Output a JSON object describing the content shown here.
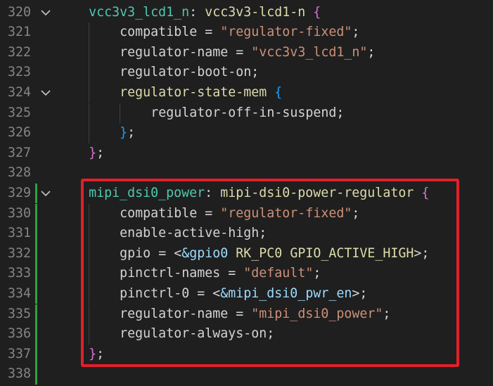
{
  "colors": {
    "background": "#1f1f1f",
    "line_number": "#858585",
    "label": "#4ec9b0",
    "node_name": "#dcdcaa",
    "property": "#d4d4d4",
    "string": "#ce9178",
    "reference": "#9cdcfe",
    "brace_outer": "#da70d6",
    "brace_inner": "#179fff",
    "highlight_border": "#e0202a",
    "modified_gutter": "#2ea043"
  },
  "lines": [
    {
      "n": "320",
      "fold": true,
      "modified": false,
      "indent": 1,
      "tokens": [
        {
          "t": "vcc3v3_lcd1_n",
          "c": "label"
        },
        {
          "t": ": ",
          "c": "punct"
        },
        {
          "t": "vcc3v3-lcd1-n",
          "c": "node"
        },
        {
          "t": " ",
          "c": "punct"
        },
        {
          "t": "{",
          "c": "brace1"
        }
      ]
    },
    {
      "n": "321",
      "fold": false,
      "modified": false,
      "indent": 2,
      "tokens": [
        {
          "t": "compatible",
          "c": "prop"
        },
        {
          "t": " = ",
          "c": "punct"
        },
        {
          "t": "\"regulator-fixed\"",
          "c": "str"
        },
        {
          "t": ";",
          "c": "punct"
        }
      ]
    },
    {
      "n": "322",
      "fold": false,
      "modified": false,
      "indent": 2,
      "tokens": [
        {
          "t": "regulator-name",
          "c": "prop"
        },
        {
          "t": " = ",
          "c": "punct"
        },
        {
          "t": "\"vcc3v3_lcd1_n\"",
          "c": "str"
        },
        {
          "t": ";",
          "c": "punct"
        }
      ]
    },
    {
      "n": "323",
      "fold": false,
      "modified": false,
      "indent": 2,
      "tokens": [
        {
          "t": "regulator-boot-on",
          "c": "prop"
        },
        {
          "t": ";",
          "c": "punct"
        }
      ]
    },
    {
      "n": "324",
      "fold": true,
      "modified": false,
      "indent": 2,
      "tokens": [
        {
          "t": "regulator-state-mem",
          "c": "node"
        },
        {
          "t": " ",
          "c": "punct"
        },
        {
          "t": "{",
          "c": "brace2"
        }
      ]
    },
    {
      "n": "325",
      "fold": false,
      "modified": false,
      "indent": 3,
      "tokens": [
        {
          "t": "regulator-off-in-suspend",
          "c": "prop"
        },
        {
          "t": ";",
          "c": "punct"
        }
      ]
    },
    {
      "n": "326",
      "fold": false,
      "modified": false,
      "indent": 2,
      "tokens": [
        {
          "t": "}",
          "c": "brace2"
        },
        {
          "t": ";",
          "c": "punct"
        }
      ]
    },
    {
      "n": "327",
      "fold": false,
      "modified": false,
      "indent": 1,
      "tokens": [
        {
          "t": "}",
          "c": "brace1"
        },
        {
          "t": ";",
          "c": "punct"
        }
      ]
    },
    {
      "n": "328",
      "fold": false,
      "modified": false,
      "indent": 0,
      "tokens": []
    },
    {
      "n": "329",
      "fold": true,
      "modified": true,
      "indent": 1,
      "tokens": [
        {
          "t": "mipi_dsi0_power",
          "c": "label"
        },
        {
          "t": ": ",
          "c": "punct"
        },
        {
          "t": "mipi-dsi0-power-regulator",
          "c": "node"
        },
        {
          "t": " ",
          "c": "punct"
        },
        {
          "t": "{",
          "c": "brace1"
        }
      ]
    },
    {
      "n": "330",
      "fold": false,
      "modified": true,
      "indent": 2,
      "tokens": [
        {
          "t": "compatible",
          "c": "prop"
        },
        {
          "t": " = ",
          "c": "punct"
        },
        {
          "t": "\"regulator-fixed\"",
          "c": "str"
        },
        {
          "t": ";",
          "c": "punct"
        }
      ]
    },
    {
      "n": "331",
      "fold": false,
      "modified": true,
      "indent": 2,
      "tokens": [
        {
          "t": "enable-active-high",
          "c": "prop"
        },
        {
          "t": ";",
          "c": "punct"
        }
      ]
    },
    {
      "n": "332",
      "fold": false,
      "modified": true,
      "indent": 2,
      "tokens": [
        {
          "t": "gpio",
          "c": "prop"
        },
        {
          "t": " = <",
          "c": "punct"
        },
        {
          "t": "&gpio0",
          "c": "ref"
        },
        {
          "t": " RK_PC0 GPIO_ACTIVE_HIGH",
          "c": "node"
        },
        {
          "t": ">;",
          "c": "punct"
        }
      ]
    },
    {
      "n": "333",
      "fold": false,
      "modified": true,
      "indent": 2,
      "tokens": [
        {
          "t": "pinctrl-names",
          "c": "prop"
        },
        {
          "t": " = ",
          "c": "punct"
        },
        {
          "t": "\"default\"",
          "c": "str"
        },
        {
          "t": ";",
          "c": "punct"
        }
      ]
    },
    {
      "n": "334",
      "fold": false,
      "modified": true,
      "indent": 2,
      "tokens": [
        {
          "t": "pinctrl-0",
          "c": "prop"
        },
        {
          "t": " = <",
          "c": "punct"
        },
        {
          "t": "&mipi_dsi0_pwr_en",
          "c": "ref"
        },
        {
          "t": ">;",
          "c": "punct"
        }
      ]
    },
    {
      "n": "335",
      "fold": false,
      "modified": true,
      "indent": 2,
      "tokens": [
        {
          "t": "regulator-name",
          "c": "prop"
        },
        {
          "t": " = ",
          "c": "punct"
        },
        {
          "t": "\"mipi_dsi0_power\"",
          "c": "str"
        },
        {
          "t": ";",
          "c": "punct"
        }
      ]
    },
    {
      "n": "336",
      "fold": false,
      "modified": true,
      "indent": 2,
      "tokens": [
        {
          "t": "regulator-always-on",
          "c": "prop"
        },
        {
          "t": ";",
          "c": "punct"
        }
      ]
    },
    {
      "n": "337",
      "fold": false,
      "modified": true,
      "indent": 1,
      "tokens": [
        {
          "t": "}",
          "c": "brace1"
        },
        {
          "t": ";",
          "c": "punct"
        }
      ]
    },
    {
      "n": "338",
      "fold": false,
      "modified": true,
      "indent": 0,
      "tokens": []
    }
  ]
}
